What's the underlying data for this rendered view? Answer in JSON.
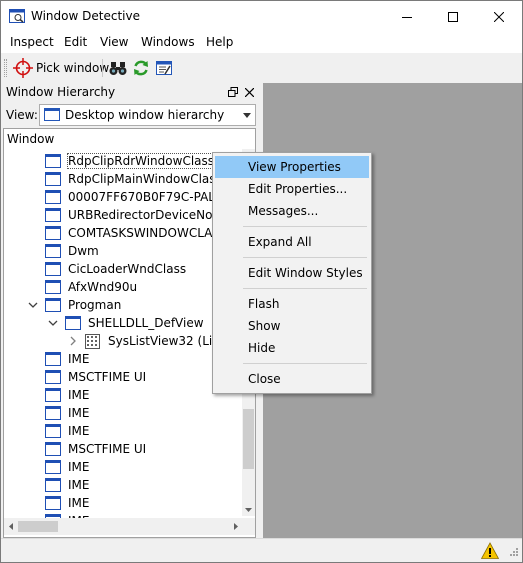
{
  "window": {
    "title": "Window Detective"
  },
  "menubar": [
    "Inspect",
    "Edit",
    "View",
    "Windows",
    "Help"
  ],
  "toolbar": {
    "pick_window_label": "Pick window"
  },
  "dock": {
    "title": "Window Hierarchy",
    "view_label": "View:",
    "view_selected": "Desktop window hierarchy",
    "tree_header": "Window",
    "items": [
      {
        "label": "RdpClipRdrWindowClass",
        "indent": 0,
        "icon": "window-icon",
        "expander": "none",
        "selected": true
      },
      {
        "label": "RdpClipMainWindowClass",
        "indent": 0,
        "icon": "window-icon",
        "expander": "none"
      },
      {
        "label": "00007FF670B0F79C-PAL_SYS",
        "indent": 0,
        "icon": "window-icon",
        "expander": "none"
      },
      {
        "label": "URBRedirectorDeviceNotific",
        "indent": 0,
        "icon": "window-icon",
        "expander": "none"
      },
      {
        "label": "COMTASKSWINDOWCLASS",
        "indent": 0,
        "icon": "window-icon",
        "expander": "none"
      },
      {
        "label": "Dwm",
        "indent": 0,
        "icon": "window-icon",
        "expander": "none"
      },
      {
        "label": "CicLoaderWndClass",
        "indent": 0,
        "icon": "window-icon",
        "expander": "none"
      },
      {
        "label": "AfxWnd90u",
        "indent": 0,
        "icon": "window-icon",
        "expander": "none"
      },
      {
        "label": "Progman",
        "indent": 0,
        "icon": "window-icon",
        "expander": "open"
      },
      {
        "label": "SHELLDLL_DefView",
        "indent": 1,
        "icon": "window-icon",
        "expander": "open"
      },
      {
        "label": "SysListView32 (List v",
        "indent": 2,
        "icon": "listview-icon",
        "expander": "closed"
      },
      {
        "label": "IME",
        "indent": 0,
        "icon": "window-icon",
        "expander": "none"
      },
      {
        "label": "MSCTFIME UI",
        "indent": 0,
        "icon": "window-icon",
        "expander": "none"
      },
      {
        "label": "IME",
        "indent": 0,
        "icon": "window-icon",
        "expander": "none"
      },
      {
        "label": "IME",
        "indent": 0,
        "icon": "window-icon",
        "expander": "none"
      },
      {
        "label": "IME",
        "indent": 0,
        "icon": "window-icon",
        "expander": "none"
      },
      {
        "label": "MSCTFIME UI",
        "indent": 0,
        "icon": "window-icon",
        "expander": "none"
      },
      {
        "label": "IME",
        "indent": 0,
        "icon": "window-icon",
        "expander": "none"
      },
      {
        "label": "IME",
        "indent": 0,
        "icon": "window-icon",
        "expander": "none"
      },
      {
        "label": "IME",
        "indent": 0,
        "icon": "window-icon",
        "expander": "none"
      },
      {
        "label": "IME",
        "indent": 0,
        "icon": "window-icon",
        "expander": "none"
      }
    ]
  },
  "context_menu": {
    "groups": [
      [
        "View Properties",
        "Edit Properties...",
        "Messages..."
      ],
      [
        "Expand All"
      ],
      [
        "Edit Window Styles"
      ],
      [
        "Flash",
        "Show",
        "Hide"
      ],
      [
        "Close"
      ]
    ],
    "highlighted": "View Properties"
  },
  "colors": {
    "highlight": "#91c9f7",
    "mdi_background": "#a0a0a0",
    "window_icon": "#1f4fb4"
  }
}
